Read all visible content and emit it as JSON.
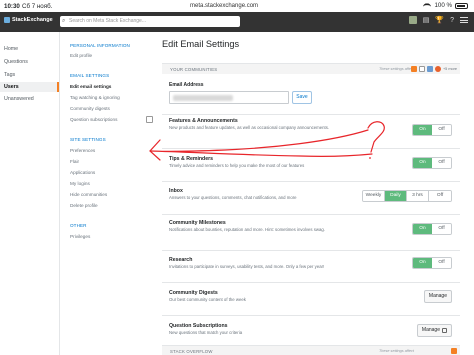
{
  "status_bar": {
    "time": "10:30",
    "date": "Сб 7 нояб.",
    "battery": "100 %"
  },
  "browser": {
    "url": "meta.stackexchange.com",
    "back": "‹",
    "forward": "›",
    "reader": "AA"
  },
  "site": {
    "logo_text": "StackExchange",
    "search_placeholder": "Search on Meta Stack Exchange..."
  },
  "left_nav": {
    "items": [
      {
        "label": "Home"
      },
      {
        "label": "Questions"
      },
      {
        "label": "Tags"
      },
      {
        "label": "Users"
      },
      {
        "label": "Unanswered"
      }
    ]
  },
  "settings_nav": {
    "personal_info": {
      "heading": "PERSONAL INFORMATION",
      "links": [
        "Edit profile"
      ]
    },
    "email_settings": {
      "heading": "EMAIL SETTINGS",
      "links": [
        "Edit email settings",
        "Tag watching & ignoring",
        "Community digests",
        "Question subscriptions"
      ]
    },
    "site_settings": {
      "heading": "SITE SETTINGS",
      "links": [
        "Preferences",
        "Flair",
        "Applications",
        "My logins",
        "Hide communities",
        "Delete profile"
      ]
    },
    "other": {
      "heading": "OTHER",
      "links": [
        "Privileges"
      ]
    }
  },
  "main": {
    "title": "Edit Email Settings",
    "your_communities": {
      "label": "YOUR COMMUNITIES",
      "affects": "These settings affect",
      "more": "+5 more"
    },
    "email": {
      "label": "Email Address",
      "value": "",
      "save_label": "Save"
    },
    "rows": [
      {
        "title": "Features & Announcements",
        "desc": "New products and feature updates, as well as occasional company announcements.",
        "control": "onoff",
        "on": "On",
        "off": "Off",
        "state": "On"
      },
      {
        "title": "Tips & Reminders",
        "desc": "Timely advice and reminders to help you make the most of our features",
        "control": "onoff",
        "on": "On",
        "off": "Off",
        "state": "On"
      },
      {
        "title": "Inbox",
        "desc": "Answers to your questions, comments, chat notifications, and more",
        "control": "freq",
        "options": [
          "Weekly",
          "Daily",
          "3 hrs",
          "Off"
        ],
        "state": "Daily"
      },
      {
        "title": "Community Milestones",
        "desc": "Notifications about bounties, reputation and more. Hint: sometimes involves swag.",
        "control": "onoff",
        "on": "On",
        "off": "Off",
        "state": "On"
      },
      {
        "title": "Research",
        "desc": "Invitations to participate in surveys, usability tests, and more. Only a few per year!",
        "control": "onoff",
        "on": "On",
        "off": "Off",
        "state": "On"
      },
      {
        "title": "Community Digests",
        "desc": "Our best community content of the week",
        "control": "manage",
        "button": "Manage"
      },
      {
        "title": "Question Subscriptions",
        "desc": "New questions that match your criteria",
        "control": "manage",
        "button": "Manage"
      }
    ],
    "stack_overflow": {
      "label": "STACK OVERFLOW",
      "affects": "These settings affect"
    }
  },
  "annotation": {
    "color": "#e8262b",
    "mark": "?"
  },
  "colors": {
    "accent_green": "#5eba7d",
    "link_blue": "#0077cc",
    "topbar": "#333333",
    "nav_active": "#f48024"
  }
}
